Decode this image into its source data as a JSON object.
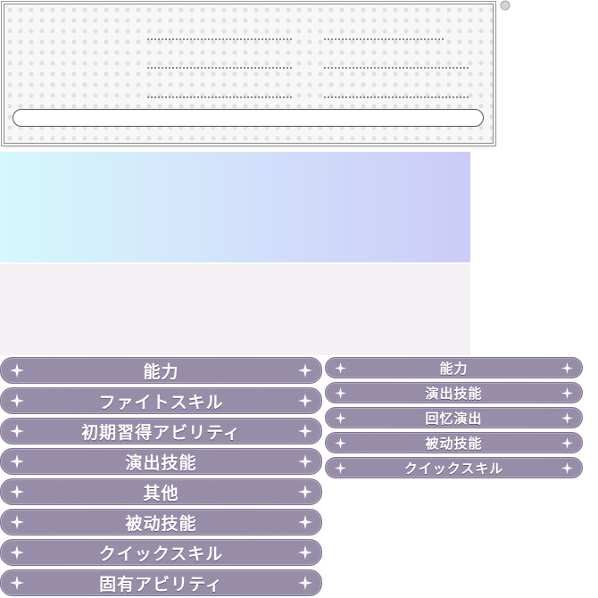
{
  "left_menu": {
    "items": [
      {
        "label": "能力"
      },
      {
        "label": "ファイトスキル"
      },
      {
        "label": "初期習得アビリティ"
      },
      {
        "label": "演出技能"
      },
      {
        "label": "其他"
      },
      {
        "label": "被动技能"
      },
      {
        "label": "クイックスキル"
      },
      {
        "label": "固有アビリティ"
      }
    ]
  },
  "right_menu": {
    "items": [
      {
        "label": "能力"
      },
      {
        "label": "演出技能"
      },
      {
        "label": "回忆演出"
      },
      {
        "label": "被动技能"
      },
      {
        "label": "クイックスキル"
      }
    ]
  },
  "colors": {
    "button_fill": "#958aa6",
    "button_text": "#ffffff",
    "gradient_start": "#d6f7fd",
    "gradient_end": "#cccbf7",
    "lower_panel": "#f4f0f4"
  },
  "icons": {
    "button_decoration": "sparkle-icon",
    "card_corner": "corner-dot-icon"
  }
}
